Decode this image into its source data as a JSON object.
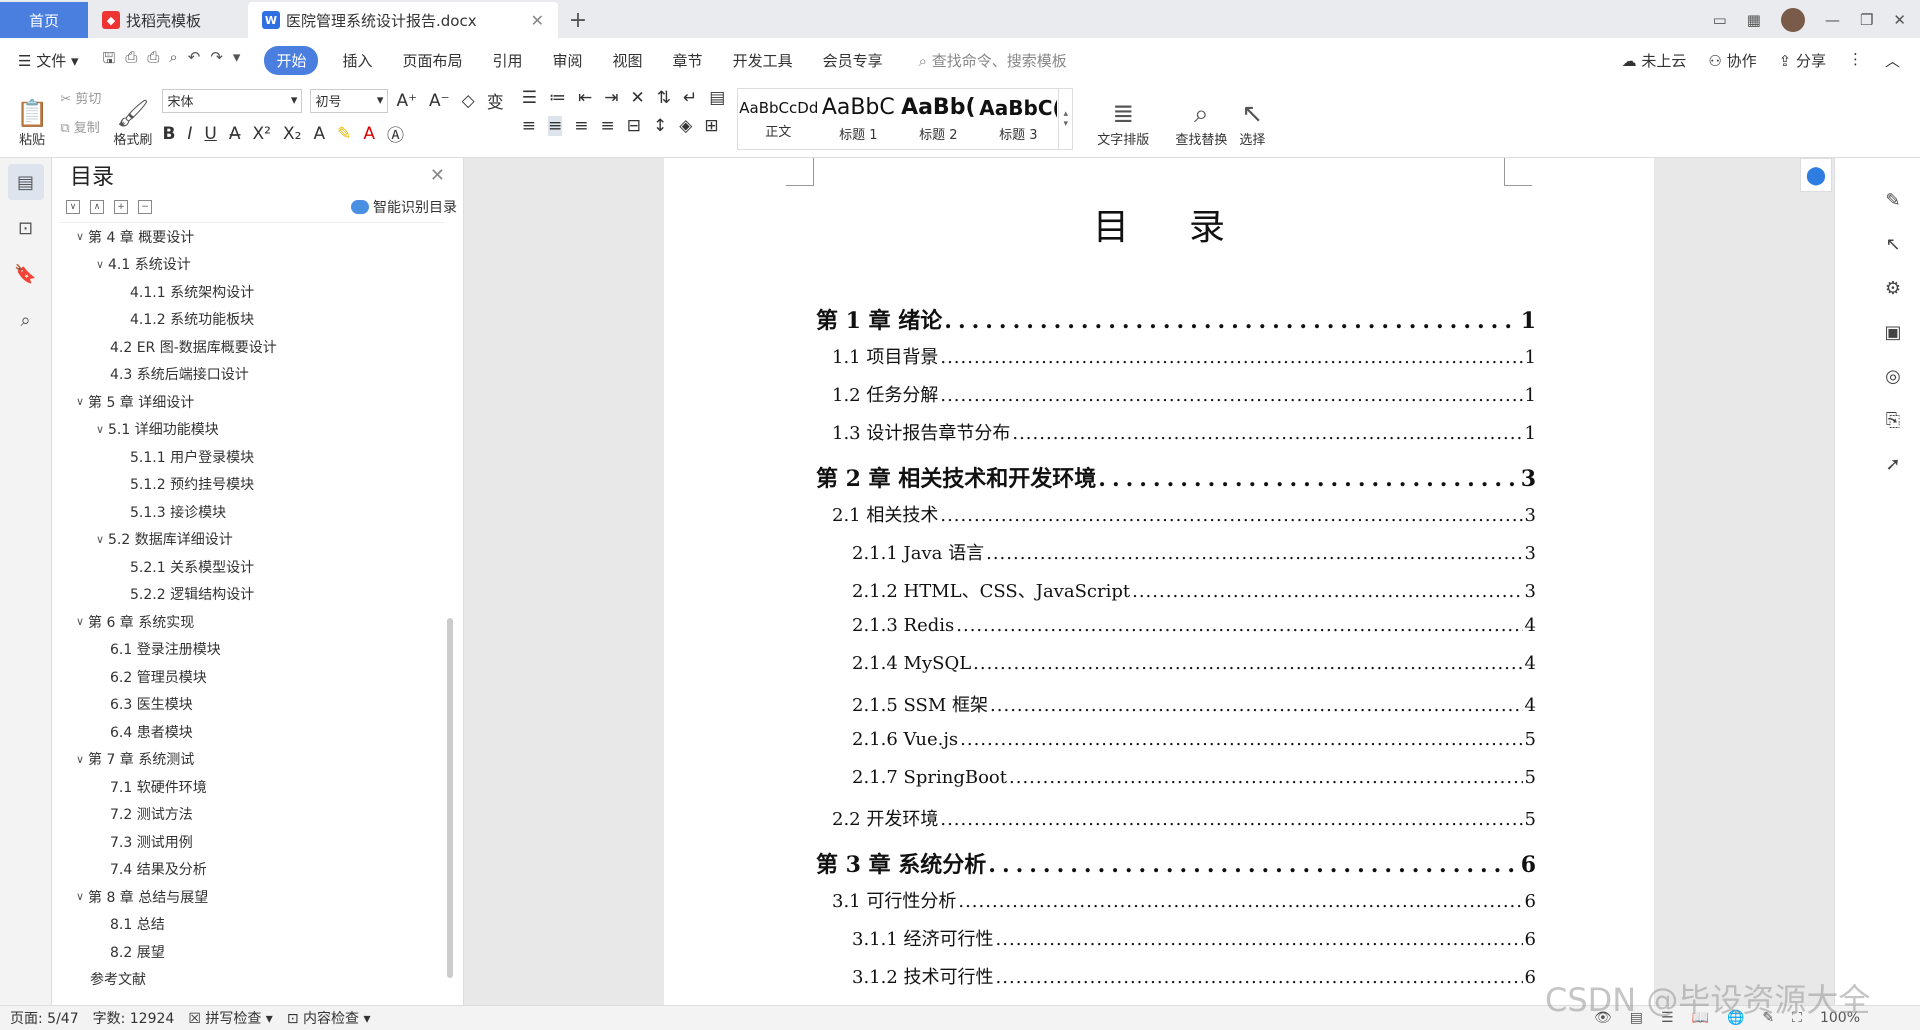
{
  "titlebar": {
    "tab_home": "首页",
    "tab_template": "找稻壳模板",
    "tab_doc": "医院管理系统设计报告.docx"
  },
  "menubar": {
    "file": "文件",
    "items": [
      "开始",
      "插入",
      "页面布局",
      "引用",
      "审阅",
      "视图",
      "章节",
      "开发工具",
      "会员专享"
    ],
    "search": "查找命令、搜索模板",
    "cloud": "未上云",
    "collab": "协作",
    "share": "分享"
  },
  "ribbon": {
    "paste": "粘贴",
    "cut": "剪切",
    "copy": "复制",
    "format_painter": "格式刷",
    "font_name": "宋体",
    "font_size": "初号",
    "styles": [
      {
        "sample": "AaBbCcDd",
        "name": "正文"
      },
      {
        "sample": "AaBbC",
        "name": "标题 1"
      },
      {
        "sample": "AaBb(",
        "name": "标题 2"
      },
      {
        "sample": "AaBbC(",
        "name": "标题 3"
      }
    ],
    "text_layout": "文字排版",
    "find_replace": "查找替换",
    "select": "选择"
  },
  "toc_panel": {
    "title": "目录",
    "smart": "智能识别目录",
    "items": [
      {
        "level": 1,
        "arrow": "∨",
        "text": "第 4 章  概要设计"
      },
      {
        "level": 2,
        "arrow": "∨",
        "text": "4.1  系统设计"
      },
      {
        "level": 3,
        "arrow": "",
        "text": "4.1.1  系统架构设计"
      },
      {
        "level": 3,
        "arrow": "",
        "text": "4.1.2  系统功能板块"
      },
      {
        "level": 2,
        "arrow": "",
        "text": "4.2  ER 图-数据库概要设计"
      },
      {
        "level": 2,
        "arrow": "",
        "text": "4.3  系统后端接口设计"
      },
      {
        "level": 1,
        "arrow": "∨",
        "text": "第 5 章  详细设计"
      },
      {
        "level": 2,
        "arrow": "∨",
        "text": "5.1  详细功能模块"
      },
      {
        "level": 3,
        "arrow": "",
        "text": "5.1.1  用户登录模块"
      },
      {
        "level": 3,
        "arrow": "",
        "text": "5.1.2  预约挂号模块"
      },
      {
        "level": 3,
        "arrow": "",
        "text": "5.1.3  接诊模块"
      },
      {
        "level": 2,
        "arrow": "∨",
        "text": "5.2  数据库详细设计"
      },
      {
        "level": 3,
        "arrow": "",
        "text": "5.2.1  关系模型设计"
      },
      {
        "level": 3,
        "arrow": "",
        "text": "5.2.2  逻辑结构设计"
      },
      {
        "level": 1,
        "arrow": "∨",
        "text": "第 6 章  系统实现"
      },
      {
        "level": 2,
        "arrow": "",
        "text": "6.1  登录注册模块"
      },
      {
        "level": 2,
        "arrow": "",
        "text": "6.2  管理员模块"
      },
      {
        "level": 2,
        "arrow": "",
        "text": "6.3  医生模块"
      },
      {
        "level": 2,
        "arrow": "",
        "text": "6.4  患者模块"
      },
      {
        "level": 1,
        "arrow": "∨",
        "text": "第 7 章  系统测试"
      },
      {
        "level": 2,
        "arrow": "",
        "text": "7.1  软硬件环境"
      },
      {
        "level": 2,
        "arrow": "",
        "text": "7.2  测试方法"
      },
      {
        "level": 2,
        "arrow": "",
        "text": "7.3  测试用例"
      },
      {
        "level": 2,
        "arrow": "",
        "text": "7.4  结果及分析"
      },
      {
        "level": 1,
        "arrow": "∨",
        "text": "第 8 章  总结与展望"
      },
      {
        "level": 2,
        "arrow": "",
        "text": "8.1  总结"
      },
      {
        "level": 2,
        "arrow": "",
        "text": "8.2  展望"
      },
      {
        "level": 1,
        "arrow": "",
        "text": "参考文献"
      }
    ]
  },
  "document": {
    "title": "目录",
    "entries": [
      {
        "level": 1,
        "text": "第 1 章  绪论",
        "page": "1"
      },
      {
        "level": 2,
        "text": "1.1  项目背景",
        "page": "1"
      },
      {
        "level": 2,
        "text": "1.2  任务分解",
        "page": "1"
      },
      {
        "level": 2,
        "text": "1.3  设计报告章节分布",
        "page": "1"
      },
      {
        "level": 1,
        "text": "第 2 章  相关技术和开发环境",
        "page": "3"
      },
      {
        "level": 2,
        "text": "2.1  相关技术",
        "page": "3"
      },
      {
        "level": 3,
        "text": "2.1.1  Java 语言",
        "page": "3"
      },
      {
        "level": 3,
        "text": "2.1.2  HTML、CSS、JavaScript",
        "page": "3"
      },
      {
        "level": 3,
        "text": "2.1.3  Redis",
        "page": "4"
      },
      {
        "level": 3,
        "text": "2.1.4  MySQL",
        "page": "4"
      },
      {
        "level": 3,
        "text": "2.1.5  SSM 框架",
        "page": "4"
      },
      {
        "level": 3,
        "text": "2.1.6  Vue.js",
        "page": "5"
      },
      {
        "level": 3,
        "text": "2.1.7  SpringBoot",
        "page": "5"
      },
      {
        "level": 2,
        "text": "2.2  开发环境",
        "page": "5"
      },
      {
        "level": 1,
        "text": "第 3 章  系统分析",
        "page": "6"
      },
      {
        "level": 2,
        "text": "3.1  可行性分析",
        "page": "6"
      },
      {
        "level": 3,
        "text": "3.1.1  经济可行性",
        "page": "6"
      },
      {
        "level": 3,
        "text": "3.1.2  技术可行性",
        "page": "6"
      }
    ]
  },
  "statusbar": {
    "page": "页面: 5/47",
    "words": "字数: 12924",
    "spell": "拼写检查",
    "content": "内容检查",
    "zoom": "100%"
  },
  "watermark": "CSDN @毕设资源大全"
}
